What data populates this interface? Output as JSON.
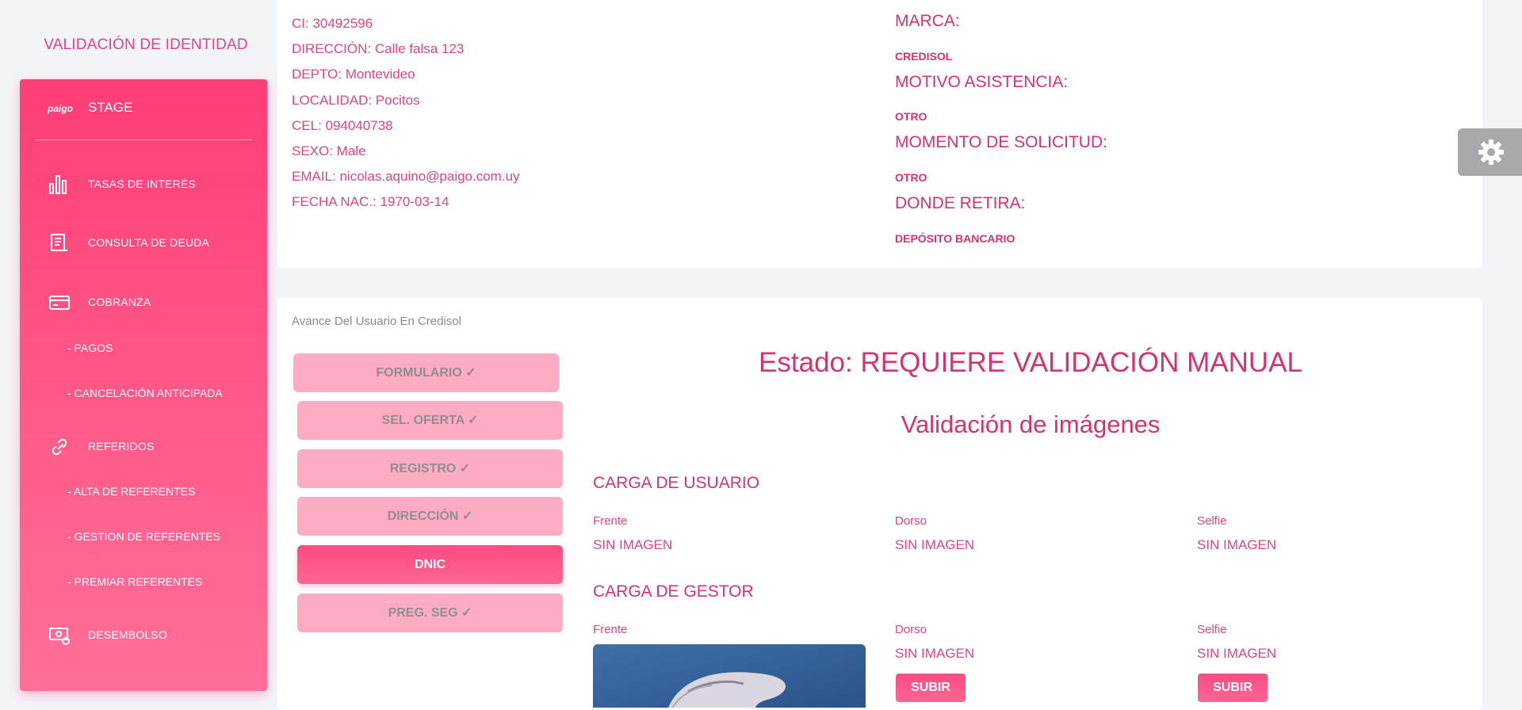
{
  "app": {
    "title": "VALIDACIÓN DE IDENTIDAD"
  },
  "sidebar": {
    "logo_text": "paigo",
    "env_label": "STAGE",
    "items": [
      {
        "label": "TASAS DE INTERÉS",
        "icon": "bar-chart-icon"
      },
      {
        "label": "CONSULTA DE DEUDA",
        "icon": "receipt-icon"
      },
      {
        "label": "COBRANZA",
        "icon": "credit-card-icon"
      },
      {
        "label": "REFERIDOS",
        "icon": "link-icon"
      },
      {
        "label": "DESEMBOLSO",
        "icon": "money-icon"
      }
    ],
    "subitems": {
      "pagos": "- PAGOS",
      "cancelacion": "- CANCELACIÓN ANTICIPADA",
      "alta": "- ALTA DE REFERENTES",
      "gestion": "- GESTION DE REFERENTES",
      "premiar": "- PREMIAR REFERENTES"
    }
  },
  "user_info": {
    "ci": "CI: 30492596",
    "direccion": "DIRECCIÓN: Calle falsa 123",
    "depto": "DEPTO: Montevideo",
    "localidad": "LOCALIDAD: Pocitos",
    "cel": "CEL: 094040738",
    "sexo": "SEXO: Male",
    "email": "EMAIL: nicolas.aquino@paigo.com.uy",
    "fecha_nac": "FECHA NAC.: 1970-03-14"
  },
  "request_info": {
    "marca_label": "MARCA:",
    "marca_value": "CREDISOL",
    "motivo_label": "MOTIVO ASISTENCIA:",
    "motivo_value": "OTRO",
    "momento_label": "MOMENTO DE SOLICITUD:",
    "momento_value": "OTRO",
    "retira_label": "DONDE RETIRA:",
    "retira_value": "DEPÓSITO BANCARIO"
  },
  "progress": {
    "title": "Avance Del Usuario En Credisol",
    "steps": [
      {
        "label": "FORMULARIO ✓",
        "active": false
      },
      {
        "label": "SEL. OFERTA ✓",
        "active": false
      },
      {
        "label": "REGISTRO ✓",
        "active": false
      },
      {
        "label": "DIRECCIÓN ✓",
        "active": false
      },
      {
        "label": "DNIC",
        "active": true
      },
      {
        "label": "PREG. SEG ✓",
        "active": false
      }
    ]
  },
  "status": {
    "estado": "Estado: REQUIERE VALIDACIÓN MANUAL",
    "validacion_title": "Validación de imágenes"
  },
  "carga_usuario": {
    "title": "CARGA DE USUARIO",
    "frente_label": "Frente",
    "frente_value": "SIN IMAGEN",
    "dorso_label": "Dorso",
    "dorso_value": "SIN IMAGEN",
    "selfie_label": "Selfie",
    "selfie_value": "SIN IMAGEN"
  },
  "carga_gestor": {
    "title": "CARGA DE GESTOR",
    "frente_label": "Frente",
    "dorso_label": "Dorso",
    "dorso_value": "SIN IMAGEN",
    "selfie_label": "Selfie",
    "selfie_value": "SIN IMAGEN",
    "upload_label": "SUBIR"
  },
  "colors": {
    "accent": "#ff3d77",
    "text_pink": "#d6336c",
    "step_inactive": "#fdacc3"
  }
}
